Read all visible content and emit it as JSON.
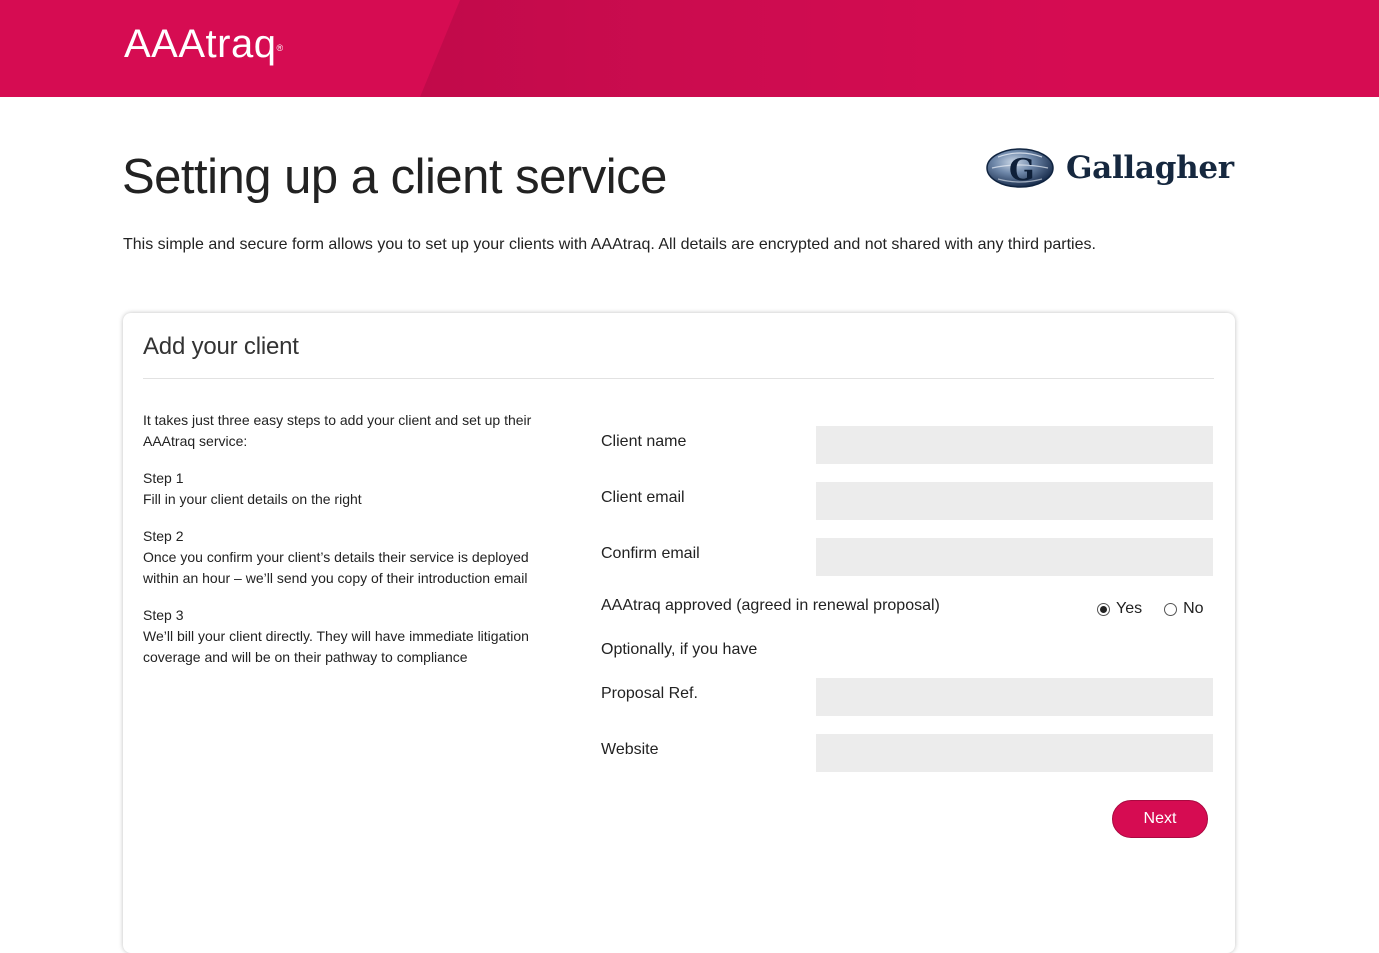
{
  "header": {
    "brand": "AAAtraq",
    "brand_mark": "®",
    "color": "#d60c52"
  },
  "page": {
    "title": "Setting up a client service",
    "intro": "This simple and secure form allows you to set up your clients with AAAtraq. All details are encrypted and not shared with any third parties."
  },
  "partner": {
    "logo_icon": "gallagher-globe-icon",
    "name": "Gallagher"
  },
  "card": {
    "title": "Add your client",
    "intro": "It takes just three easy steps to add your client and set up their AAAtraq service:",
    "steps": [
      {
        "label": "Step 1",
        "text": "Fill in your client details on the right"
      },
      {
        "label": "Step 2",
        "text": "Once you confirm your client’s details their service is deployed within an hour – we’ll send you copy of their introduction email"
      },
      {
        "label": "Step 3",
        "text": "We’ll bill your client directly. They will have immediate litigation coverage and will be on their pathway to compliance"
      }
    ]
  },
  "form": {
    "client_name": {
      "label": "Client name",
      "value": ""
    },
    "client_email": {
      "label": "Client email",
      "value": ""
    },
    "confirm_email": {
      "label": "Confirm email",
      "value": ""
    },
    "approved": {
      "label": "AAAtraq approved (agreed in renewal proposal)",
      "options": [
        "Yes",
        "No"
      ],
      "selected": "Yes"
    },
    "optional_note": "Optionally, if you have",
    "proposal_ref": {
      "label": "Proposal Ref.",
      "value": ""
    },
    "website": {
      "label": "Website",
      "value": ""
    },
    "next_label": "Next"
  }
}
